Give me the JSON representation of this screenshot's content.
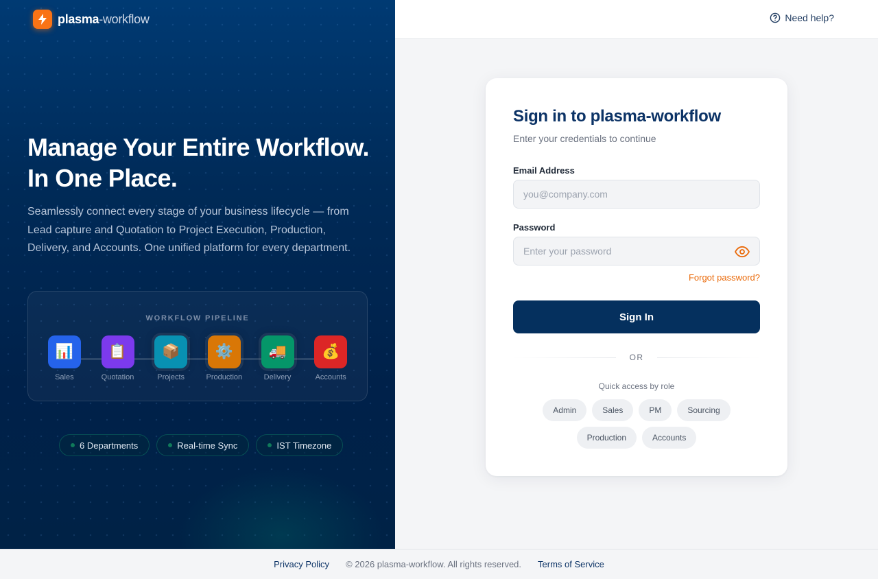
{
  "brand": {
    "name_bold": "plasma",
    "name_rest": "-workflow"
  },
  "hero": {
    "title_line1": "Manage Your Entire Workflow.",
    "title_line2": "In One Place.",
    "subtitle": "Seamlessly connect every stage of your business lifecycle — from Lead capture and Quotation to Project Execution, Production, Delivery, and Accounts. One unified platform for every department."
  },
  "pipeline": {
    "title": "WORKFLOW PIPELINE",
    "steps": [
      {
        "label": "Sales",
        "icon": "📊",
        "color": "#2563eb"
      },
      {
        "label": "Quotation",
        "icon": "📋",
        "color": "#7c3aed"
      },
      {
        "label": "Projects",
        "icon": "📦",
        "color": "#0891b2"
      },
      {
        "label": "Production",
        "icon": "⚙️",
        "color": "#d97706"
      },
      {
        "label": "Delivery",
        "icon": "🚚",
        "color": "#059669"
      },
      {
        "label": "Accounts",
        "icon": "💰",
        "color": "#dc2626"
      }
    ]
  },
  "chips": [
    "6 Departments",
    "Real-time Sync",
    "IST Timezone"
  ],
  "topbar": {
    "help": "Need help?"
  },
  "login": {
    "title": "Sign in to plasma-workflow",
    "subtitle": "Enter your credentials to continue",
    "email_label": "Email Address",
    "email_placeholder": "you@company.com",
    "password_label": "Password",
    "password_placeholder": "Enter your password",
    "forgot": "Forgot password?",
    "signin": "Sign In",
    "or": "OR",
    "quick_access": "Quick access by role",
    "roles": [
      "Admin",
      "Sales",
      "PM",
      "Sourcing",
      "Production",
      "Accounts"
    ]
  },
  "footer": {
    "privacy": "Privacy Policy",
    "copyright": "© 2026 plasma-workflow. All rights reserved.",
    "terms": "Terms of Service"
  },
  "colors": {
    "accent": "#f97316",
    "primary": "#05305e"
  }
}
